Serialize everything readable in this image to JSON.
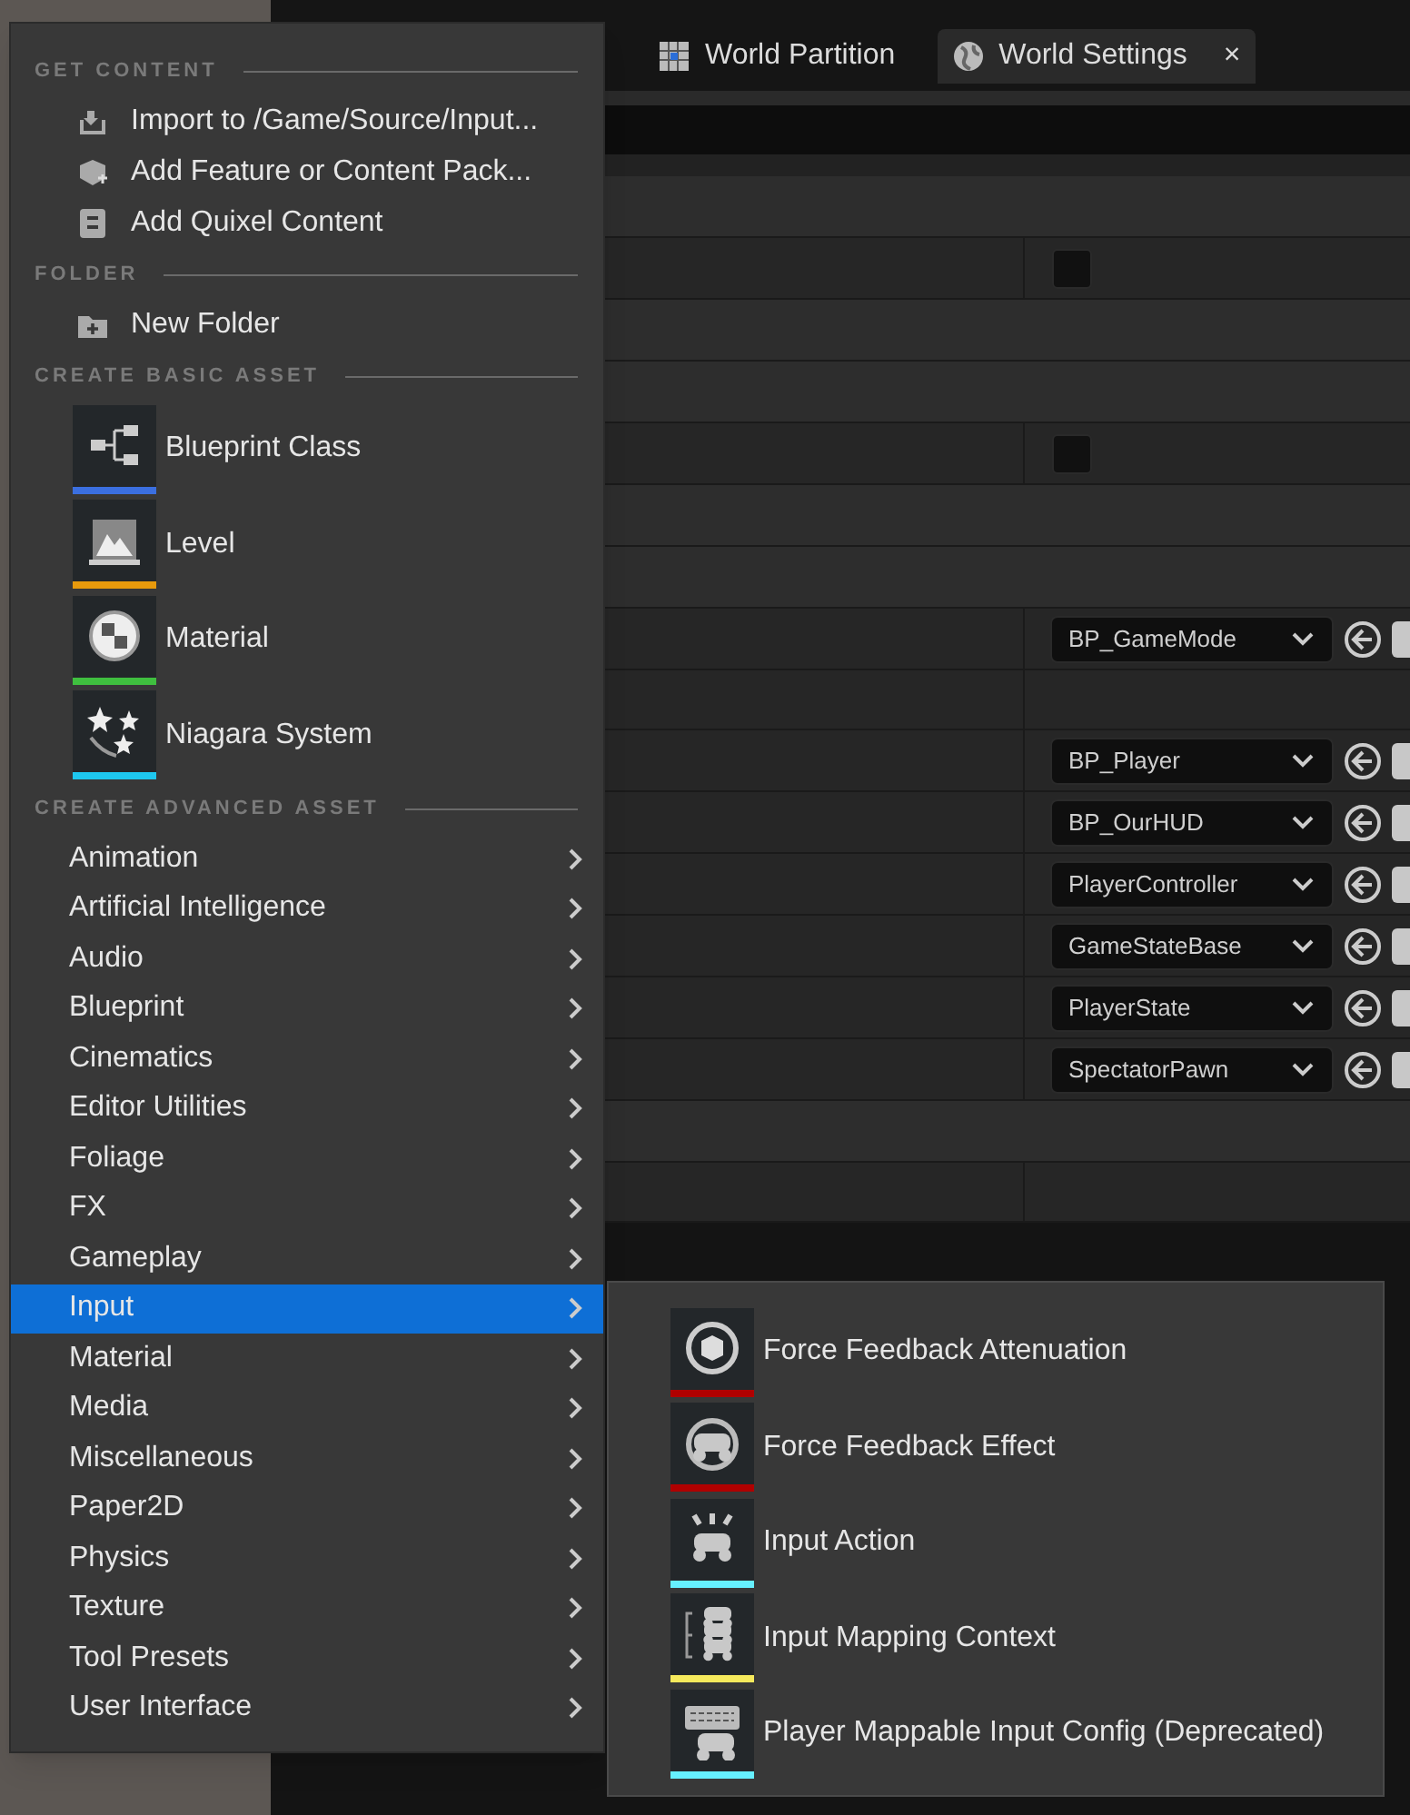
{
  "tabs": [
    {
      "label": "World Partition",
      "selected": false
    },
    {
      "label": "World Settings",
      "selected": true,
      "close": "×"
    }
  ],
  "properties": [
    {
      "kind": "header"
    },
    {
      "kind": "checkbox",
      "checked": false
    },
    {
      "kind": "header"
    },
    {
      "kind": "header"
    },
    {
      "kind": "checkbox",
      "checked": false
    },
    {
      "kind": "header"
    },
    {
      "kind": "header"
    },
    {
      "kind": "dropdown",
      "value": "BP_GameMode"
    },
    {
      "kind": "blank"
    },
    {
      "kind": "dropdown",
      "value": "BP_Player"
    },
    {
      "kind": "dropdown",
      "value": "BP_OurHUD"
    },
    {
      "kind": "dropdown",
      "value": "PlayerController"
    },
    {
      "kind": "dropdown",
      "value": "GameStateBase"
    },
    {
      "kind": "dropdown",
      "value": "PlayerState"
    },
    {
      "kind": "dropdown",
      "value": "SpectatorPawn"
    },
    {
      "kind": "header"
    },
    {
      "kind": "blank"
    }
  ],
  "menu": [
    {
      "heading": "GET CONTENT",
      "items": [
        {
          "kind": "small",
          "label": "Import to /Game/Source/Input..."
        },
        {
          "kind": "small",
          "label": "Add Feature or Content Pack..."
        },
        {
          "kind": "small",
          "label": "Add Quixel Content"
        }
      ]
    },
    {
      "heading": "FOLDER",
      "items": [
        {
          "kind": "small",
          "label": "New Folder"
        }
      ]
    },
    {
      "heading": "CREATE BASIC ASSET",
      "items": [
        {
          "kind": "asset",
          "label": "Blueprint Class",
          "color": "#3b6fe0"
        },
        {
          "kind": "asset",
          "label": "Level",
          "color": "#e89a0c"
        },
        {
          "kind": "asset",
          "label": "Material",
          "color": "#3fbf3f"
        },
        {
          "kind": "asset",
          "label": "Niagara System",
          "color": "#1ec8f0"
        }
      ]
    },
    {
      "heading": "CREATE ADVANCED ASSET",
      "items": [
        {
          "kind": "submenu",
          "label": "Animation",
          "selected": false
        },
        {
          "kind": "submenu",
          "label": "Artificial Intelligence",
          "selected": false
        },
        {
          "kind": "submenu",
          "label": "Audio",
          "selected": false
        },
        {
          "kind": "submenu",
          "label": "Blueprint",
          "selected": false
        },
        {
          "kind": "submenu",
          "label": "Cinematics",
          "selected": false
        },
        {
          "kind": "submenu",
          "label": "Editor Utilities",
          "selected": false
        },
        {
          "kind": "submenu",
          "label": "Foliage",
          "selected": false
        },
        {
          "kind": "submenu",
          "label": "FX",
          "selected": false
        },
        {
          "kind": "submenu",
          "label": "Gameplay",
          "selected": false
        },
        {
          "kind": "submenu",
          "label": "Input",
          "selected": true
        },
        {
          "kind": "submenu",
          "label": "Material",
          "selected": false
        },
        {
          "kind": "submenu",
          "label": "Media",
          "selected": false
        },
        {
          "kind": "submenu",
          "label": "Miscellaneous",
          "selected": false
        },
        {
          "kind": "submenu",
          "label": "Paper2D",
          "selected": false
        },
        {
          "kind": "submenu",
          "label": "Physics",
          "selected": false
        },
        {
          "kind": "submenu",
          "label": "Texture",
          "selected": false
        },
        {
          "kind": "submenu",
          "label": "Tool Presets",
          "selected": false
        },
        {
          "kind": "submenu",
          "label": "User Interface",
          "selected": false
        }
      ]
    }
  ],
  "submenu": [
    {
      "label": "Force Feedback Attenuation",
      "color": "#b00000"
    },
    {
      "label": "Force Feedback Effect",
      "color": "#b00000"
    },
    {
      "label": "Input Action",
      "color": "#66f0ff"
    },
    {
      "label": "Input Mapping Context",
      "color": "#f5e95c"
    },
    {
      "label": "Player Mappable Input Config (Deprecated)",
      "color": "#66f0ff"
    }
  ]
}
